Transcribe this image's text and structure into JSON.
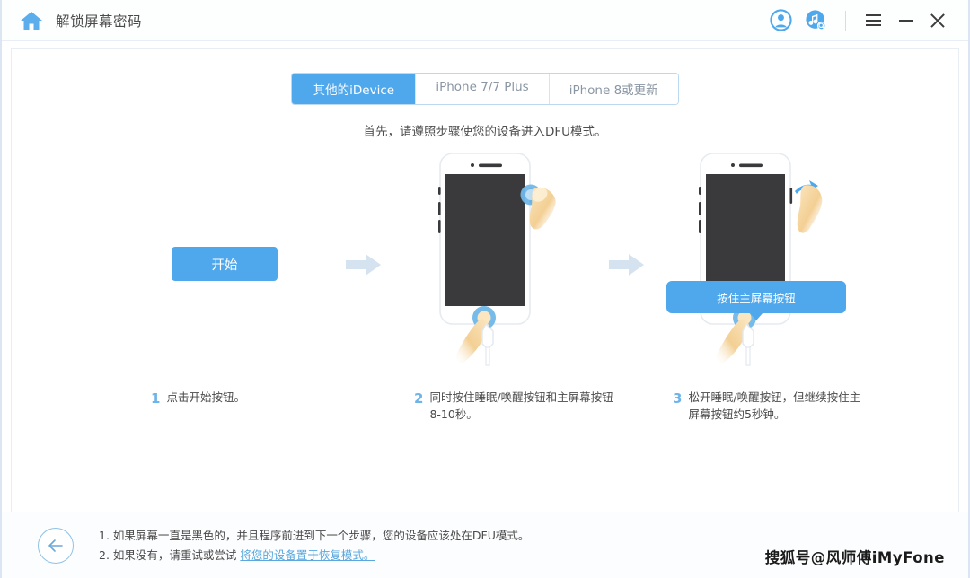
{
  "window": {
    "title": "解锁屏幕密码",
    "home_icon": "home-icon",
    "account_icon": "user-account-icon",
    "music_search_icon": "music-search-icon",
    "menu_icon": "hamburger-menu-icon",
    "minimize_icon": "minimize-icon",
    "close_icon": "close-icon"
  },
  "colors": {
    "accent": "#4FA8EC",
    "accent_light": "#8fc2e6",
    "arrow": "#d5e2f0",
    "link": "#5aa8dd",
    "screen": "#3a3a3c"
  },
  "tabs": [
    {
      "label": "其他的iDevice",
      "active": true
    },
    {
      "label": "iPhone 7/7 Plus",
      "active": false
    },
    {
      "label": "iPhone 8或更新",
      "active": false
    }
  ],
  "subtitle": "首先，请遵照步骤使您的设备进入DFU模式。",
  "start_button": {
    "label": "开始"
  },
  "tooltip": {
    "label": "按住主屏幕按钮"
  },
  "steps": [
    {
      "num": "1",
      "text": "点击开始按钮。"
    },
    {
      "num": "2",
      "text": "同时按住睡眠/唤醒按钮和主屏幕按钮8-10秒。"
    },
    {
      "num": "3",
      "text": "松开睡眠/唤醒按钮，但继续按住主屏幕按钮约5秒钟。"
    }
  ],
  "footer": {
    "back_icon": "back-arrow-icon",
    "note1": "1. 如果屏幕一直是黑色的，并且程序前进到下一个步骤，您的设备应该处在DFU模式。",
    "note2_prefix": "2. 如果没有，请重试或尝试 ",
    "note2_link": "将您的设备置于恢复模式。",
    "watermark": "搜狐号@风师傅iMyFone"
  }
}
